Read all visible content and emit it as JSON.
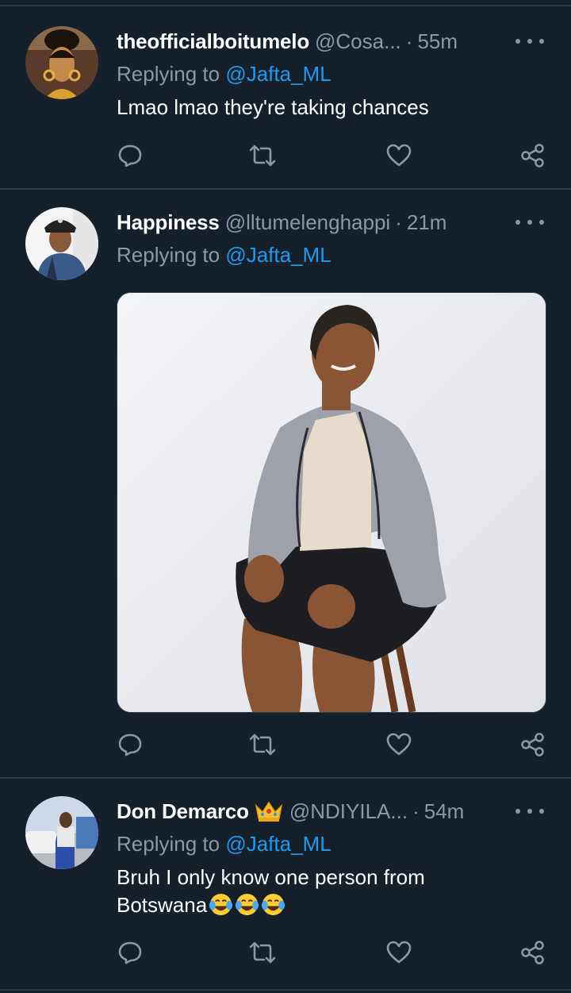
{
  "tweets": [
    {
      "name": "theofficialboitumelo",
      "handle": "@Cosa...",
      "dot": "·",
      "time": "55m",
      "reply_prefix": "Replying to",
      "reply_mention": "@Jafta_ML",
      "text": "Lmao lmao they're taking chances"
    },
    {
      "name": "Happiness",
      "handle": "@lltumelenghappi",
      "dot": "·",
      "time": "21m",
      "reply_prefix": "Replying to",
      "reply_mention": "@Jafta_ML",
      "text": ""
    },
    {
      "name": "Don Demarco",
      "handle": "@NDIYILA...",
      "dot": "·",
      "time": "54m",
      "reply_prefix": "Replying to",
      "reply_mention": "@Jafta_ML",
      "text_line1": "Bruh I only know one person from",
      "text_line2": "Botswana"
    }
  ],
  "icons": {
    "reply": "reply-icon",
    "retweet": "retweet-icon",
    "like": "heart-icon",
    "share": "share-icon",
    "more": "more-icon",
    "crown": "crown-emoji",
    "laugh": "tears-of-joy-emoji"
  },
  "colors": {
    "background": "#15202b",
    "separator": "#2f3b47",
    "secondary_text": "#8b98a5",
    "mention": "#1d9bf0"
  }
}
